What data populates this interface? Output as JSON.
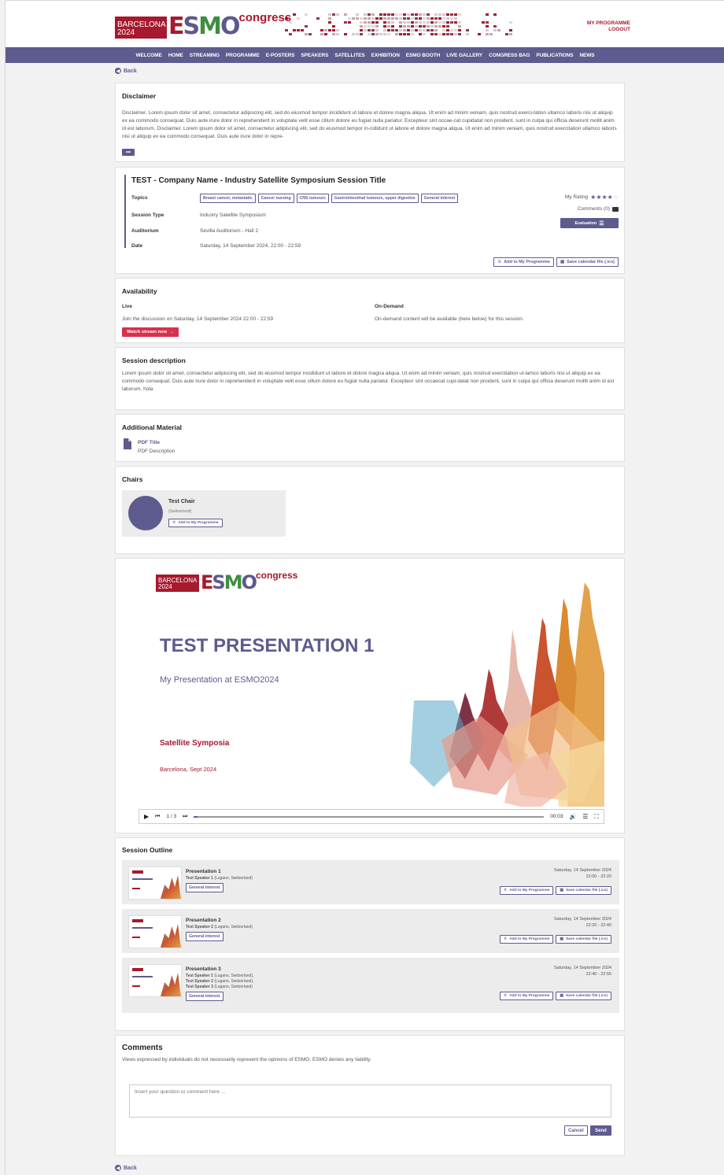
{
  "header": {
    "logo": {
      "city": "BARCELONA",
      "year": "2024",
      "brand": "ESMO",
      "suffix": "congress"
    },
    "my_programme": "MY PROGRAMME",
    "logout": "LOGOUT"
  },
  "nav": {
    "items": [
      "WELCOME",
      "HOME",
      "STREAMING",
      "PROGRAMME",
      "E-POSTERS",
      "SPEAKERS",
      "SATELLITES",
      "EXHIBITION",
      "ESMO BOOTH",
      "LIVE GALLERY",
      "CONGRESS BAG",
      "PUBLICATIONS",
      "NEWS"
    ]
  },
  "back_label": "Back",
  "disclaimer": {
    "title": "Disclaimer",
    "text": "Disclaimer. Lorem ipsum dolor sit amet, consectetur adipiscing elit, sed do eiusmod tempor incididunt ut labore et dolore magna aliqua. Ut enim ad minim veniam, quis nostrud exerci-tation ullamco laboris nisi ut aliquip ex ea commodo consequat. Duis aute irure dolor in reprehenderit in voluptate velit esse cillum dolore eu fugiat nulla pariatur. Excepteur sint occae-cat cupidatat non proident, sunt in culpa qui officia deserunt mollit anim id est laborum. Disclaimer. Lorem ipsum dolor sit amet, consectetur adipiscing elit, sed do eiusmod tempor in-cididunt ut labore et dolore magna aliqua. Ut enim ad minim veniam, quis nostrud exercitation ullamco laboris nisi ut aliquip ex ea commodo consequat. Duis aute irure dolor in repre-",
    "more_label": "•••"
  },
  "session": {
    "title": "TEST - Company Name - Industry Satellite Symposium Session Title",
    "topics_label": "Topics",
    "topics": [
      "Breast cancer, metastatic",
      "Cancer nursing",
      "CNS tumours",
      "Gastrointestinal tumours, upper digestive",
      "General interest"
    ],
    "type_label": "Session Type",
    "type": "Industry Satellite Symposium",
    "auditorium_label": "Auditorium",
    "auditorium": "Sevilla Auditorium - Hall 2",
    "date_label": "Date",
    "date": "Saturday, 14 September 2024, 22:00 - 22:59",
    "my_rating_label": "My Rating",
    "rating": 4,
    "rating_max": 5,
    "comments_label": "Comments (0)",
    "evaluation_label": "Evaluation",
    "add_programme_label": "Add to My Programme",
    "save_calendar_label": "Save calendar file (.ics)"
  },
  "availability": {
    "title": "Availability",
    "live_label": "Live",
    "live_text": "Join the discussion on Saturday, 14 September 2024 22:00 - 22:59",
    "watch_label": "Watch stream now",
    "ondemand_label": "On-Demand",
    "ondemand_text": "On-demand content will be available (here below) for this session."
  },
  "description": {
    "title": "Session description",
    "text": "Lorem ipsum dolor sit amet, consectetur adipiscing elit, sed do eiusmod tempor incididunt ut labore et dolore magna aliqua. Ut enim ad minim veniam, quis nostrud exercitation ul-lamco laboris nisi ut aliquip ex ea commodo consequat. Duis aute irure dolor in reprehenderit in voluptate velit esse cillum dolore eu fugiat nulla pariatur. Excepteur sint occaecat cupi-datat non proident, sunt in culpa qui officia deserunt mollit anim id est laborum. hola"
  },
  "material": {
    "title": "Additional Material",
    "pdf_title": "PDF Title",
    "pdf_desc": "PDF Description"
  },
  "chairs": {
    "title": "Chairs",
    "name": "Test Chair",
    "country": "(Switzerland)",
    "add_label": "Add to My Programme"
  },
  "player": {
    "slide_title": "TEST PRESENTATION 1",
    "slide_subtitle": "My Presentation at ESMO2024",
    "slide_section": "Satellite Symposia",
    "slide_place": "Barcelona, Sept 2024",
    "page": "1 / 3",
    "time": "00:03",
    "progress": 0.01
  },
  "outline": {
    "title": "Session Outline",
    "items": [
      {
        "title": "Presentation 1",
        "speakers": [
          {
            "name": "Test Speaker 1",
            "affil": " (Lugano, Switzerland)"
          }
        ],
        "tag": "General interest",
        "date": "Saturday, 14 September 2024",
        "time": "22:00 - 22:20"
      },
      {
        "title": "Presentation 2",
        "speakers": [
          {
            "name": "Test Speaker 2",
            "affil": " (Lugano, Switzerland)"
          }
        ],
        "tag": "General interest",
        "date": "Saturday, 14 September 2024",
        "time": "22:20 - 22:40"
      },
      {
        "title": "Presentation 3",
        "speakers": [
          {
            "name": "Test Speaker 1",
            "affil": " (Lugano, Switzerland),"
          },
          {
            "name": "Test Speaker 2",
            "affil": " (Lugano, Switzerland),"
          },
          {
            "name": "Test Speaker 3",
            "affil": " (Lugano, Switzerland)"
          }
        ],
        "tag": "General interest",
        "date": "Saturday, 14 September 2024",
        "time": "22:40 - 22:55"
      }
    ],
    "add_label": "Add to My Programme",
    "save_label": "Save calendar file (.ics)"
  },
  "comments": {
    "title": "Comments",
    "note": "Views expressed by individuals do not necessarily represent the opinions of ESMO. ESMO denies any liability.",
    "placeholder": "Insert your question or comment here ...",
    "cancel": "Cancel",
    "send": "Send"
  },
  "colors": {
    "primary": "#5e5b8e",
    "brand_red": "#a6192e",
    "live_red": "#d9304c"
  }
}
